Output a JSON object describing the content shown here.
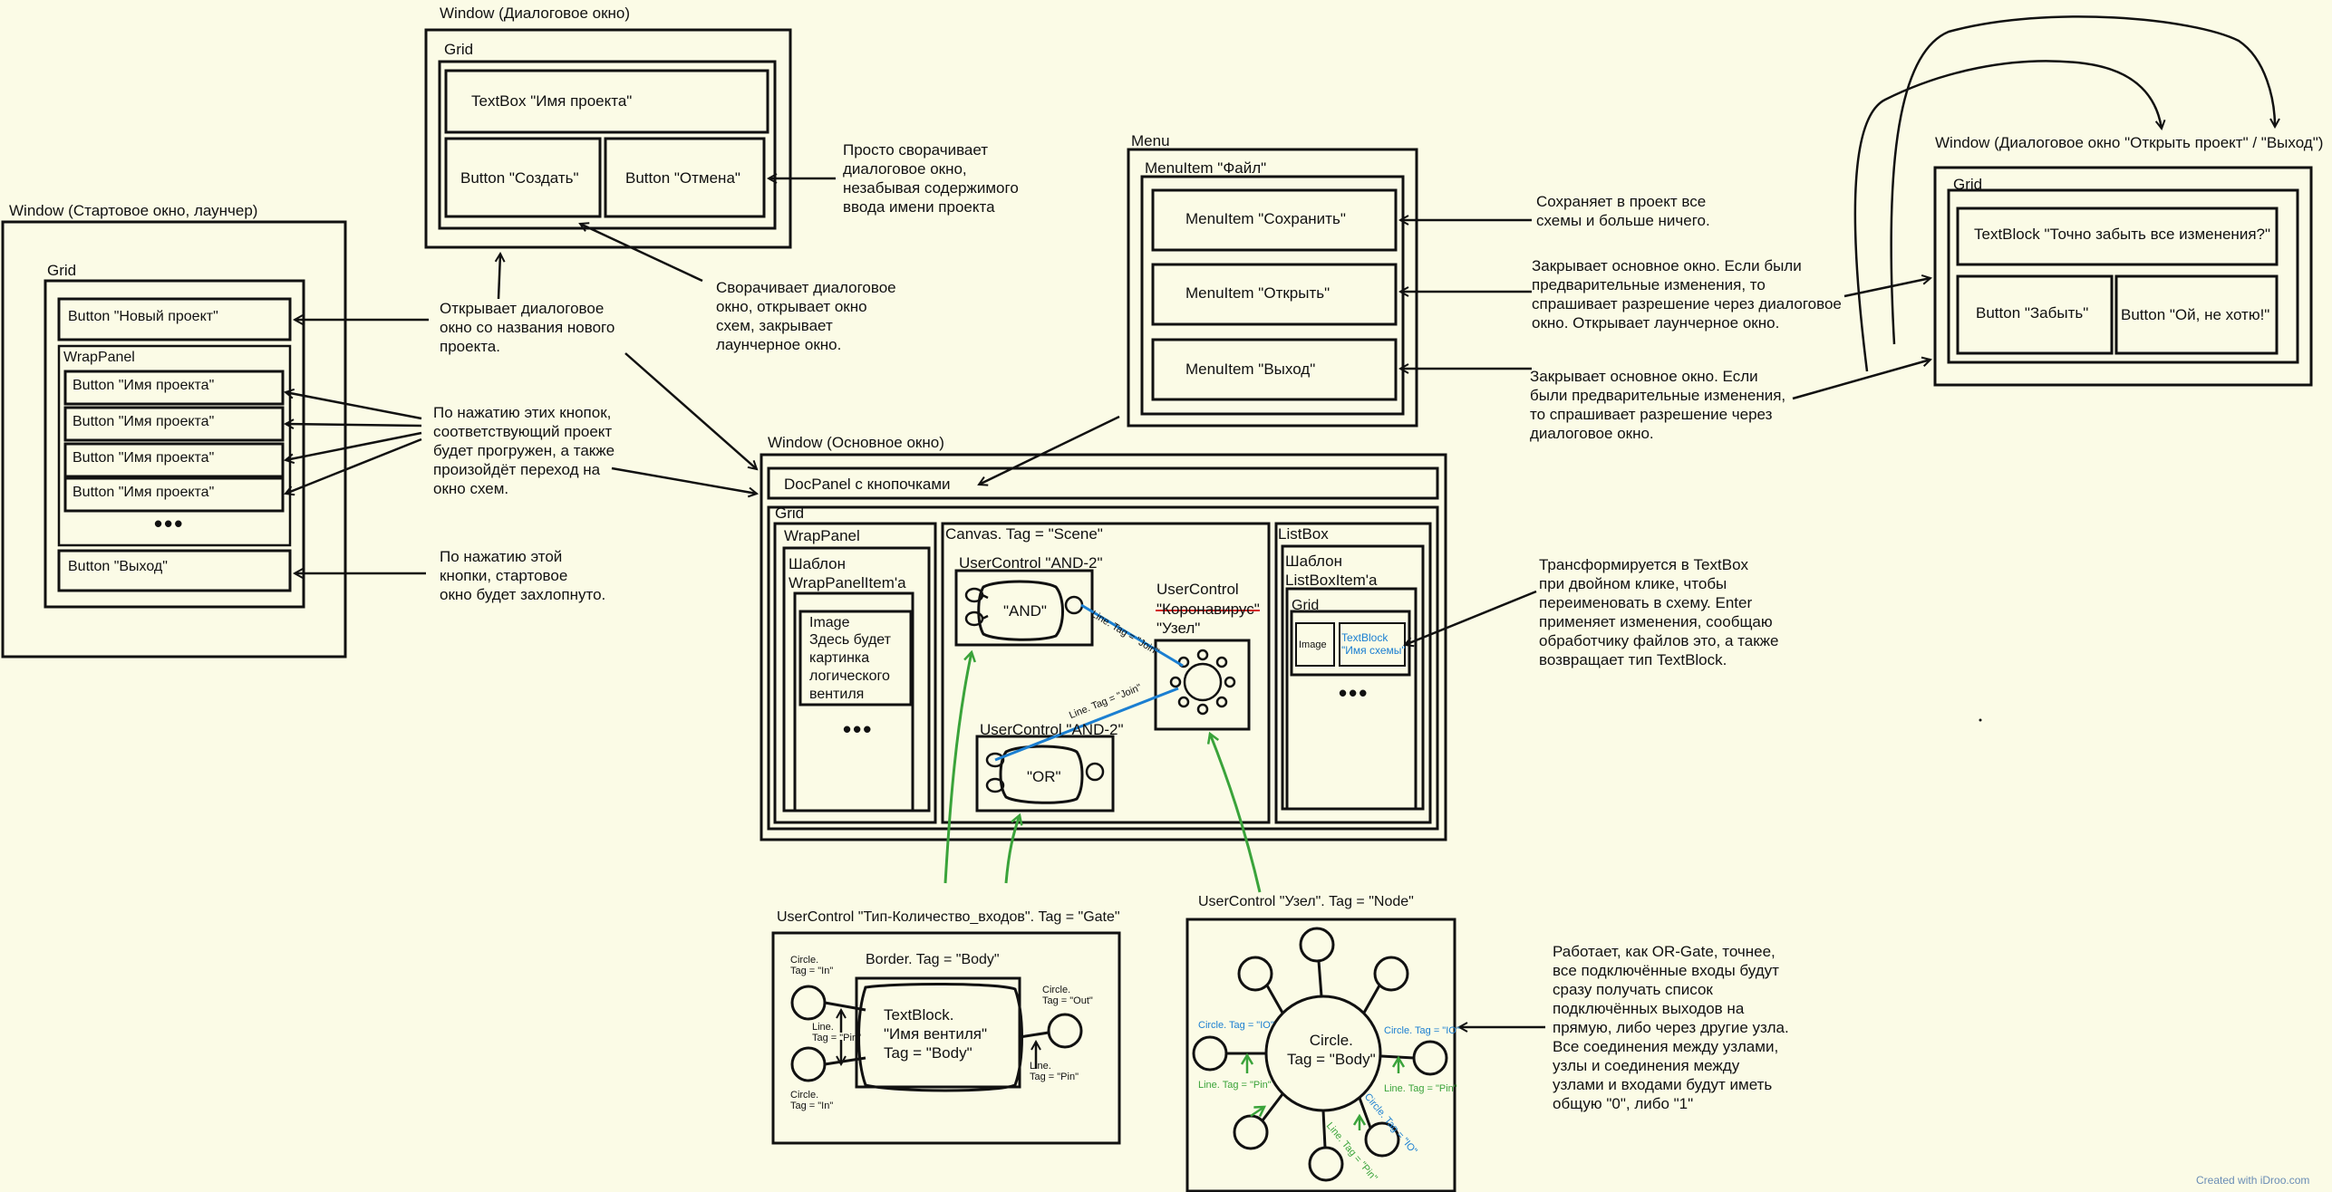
{
  "launcher": {
    "window_title": "Window (Стартовое окно, лаунчер)",
    "grid": "Grid",
    "new_project_btn": "Button \"Новый проект\"",
    "wrap_panel": "WrapPanel",
    "project_buttons": [
      "Button \"Имя проекта\"",
      "Button \"Имя проекта\"",
      "Button \"Имя проекта\"",
      "Button \"Имя проекта\""
    ],
    "ellipsis": "•••",
    "exit_btn": "Button \"Выход\""
  },
  "create_dialog": {
    "window_title": "Window (Диалоговое окно)",
    "grid": "Grid",
    "textbox": "TextBox \"Имя проекта\"",
    "create_btn": "Button \"Создать\"",
    "cancel_btn": "Button \"Отмена\""
  },
  "menu": {
    "title": "Menu",
    "file_item": "MenuItem \"Файл\"",
    "save": "MenuItem \"Сохранить\"",
    "open": "MenuItem \"Открыть\"",
    "exit": "MenuItem \"Выход\""
  },
  "confirm_dialog": {
    "window_title": "Window (Диалоговое окно \"Открыть проект\" / \"Выход\")",
    "grid": "Grid",
    "textblock": "TextBlock \"Точно забыть все изменения?\"",
    "forget_btn": "Button \"Забыть\"",
    "no_btn": "Button \"Ой, не хотю!\""
  },
  "main_window": {
    "window_title": "Window (Основное окно)",
    "docpanel": "DocPanel с кнопочками",
    "grid": "Grid",
    "wrap_panel": "WrapPanel",
    "template_wrap": "Шаблон\nWrapPanelItem'a",
    "image": "Image",
    "image_text": "Здесь будет\nкартинка\nлогического\nвентиля",
    "canvas": "Canvas. Tag = \"Scene\"",
    "uc_and_top": "UserControl \"AND-2\"",
    "and_label": "\"AND\"",
    "uc_and_bottom": "UserControl \"AND-2\"",
    "or_label": "\"OR\"",
    "uc_node_title": "UserControl",
    "uc_node_struck": "\"Коронавирус\"",
    "uc_node_name": "\"Узел\"",
    "line_join_1": "Line. Tag = \"Join\"",
    "line_join_2": "Line. Tag = \"Join\"",
    "listbox": "ListBox",
    "template_list": "Шаблон\nListBoxItem'a",
    "list_grid": "Grid",
    "list_image": "Image",
    "list_textblock": "TextBlock\n\"Имя схемы\""
  },
  "gate_detail": {
    "title": "UserControl \"Тип-Количество_входов\". Tag = \"Gate\"",
    "border": "Border. Tag = \"Body\"",
    "body_text": "TextBlock.\n\"Имя вентиля\"\nTag = \"Body\"",
    "circle_in_1": "Circle.\nTag = \"In\"",
    "circle_in_2": "Circle.\nTag = \"In\"",
    "circle_out": "Circle.\nTag = \"Out\"",
    "line_pin_left": "Line.\nTag = \"Pin\"",
    "line_pin_right": "Line.\nTag = \"Pin\""
  },
  "node_detail": {
    "title": "UserControl \"Узел\". Tag = \"Node\"",
    "body": "Circle.\nTag = \"Body\"",
    "io_left": "Circle. Tag = \"IO\"",
    "io_right": "Circle. Tag = \"IO\"",
    "io_diag": "Circle. Tag = \"IO\"",
    "pin_left": "Line. Tag = \"Pin\"",
    "pin_right": "Line. Tag = \"Pin\"",
    "pin_bottom": "Line. Tag = \"Pin\""
  },
  "notes": {
    "new_project": "Открывает диалоговое\nокно со названия нового\nпроекта.",
    "project_buttons": "По нажатию этих кнопок,\nсоответствующий проект\nбудет прогружен, а также\nпроизойдёт переход на\nокно схем.",
    "exit": "По нажатию этой\nкнопки, стартовое\nокно будет захлопнуто.",
    "cancel": "Просто сворачивает\nдиалоговое окно,\nнезабывая содержимого\nввода имени проекта",
    "create": "Сворачивает диалоговое\nокно, открывает окно\nсхем, закрывает\nлаунчерное окно.",
    "save": "Сохраняет в проект все\nсхемы и больше ничего.",
    "open": "Закрывает основное окно. Если были\nпредварительные изменения, то\nспрашивает разрешение через диалоговое\nокно. Открывает лаунчерное окно.",
    "menu_exit": "Закрывает основное окно. Если\nбыли предварительные изменения,\nто спрашивает разрешение через\nдиалоговое окно.",
    "rename": "Трансформируется в TextBox\nпри двойном клике, чтобы\nпереименовать в схему. Enter\nприменяет изменения, сообщаю\nобработчику файлов это, а также\nвозвращает тип TextBlock.",
    "node": "Работает, как OR-Gate, точнее,\nвсе подключённые входы будут\nсразу получать список\nподключённых выходов на\nпрямую, либо через другие узла.\nВсе соединения между узлами,\nузлы и соединения между\nузлами и входами будут иметь\nобщую \"0\", либо \"1\""
  },
  "watermark": "Created with iDroo.com",
  "colors": {
    "background": "#fbfbe6",
    "ink": "#111111",
    "blue": "#1b7fd1",
    "green": "#3aa33a",
    "strike": "#d22222"
  }
}
